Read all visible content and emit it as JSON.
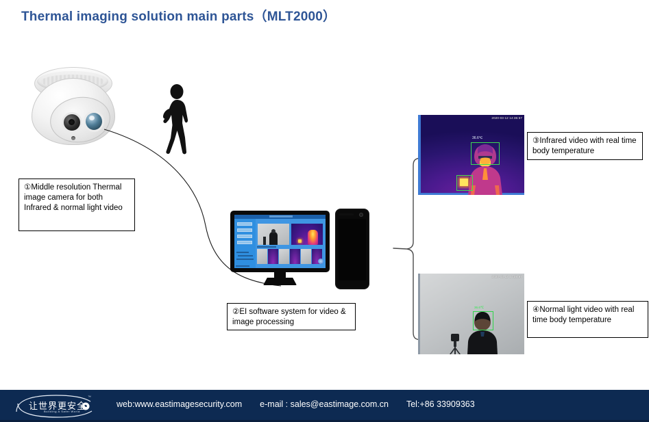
{
  "slide": {
    "title": "Thermal imaging solution  main parts（MLT2000）"
  },
  "callouts": [
    {
      "id": 1,
      "marker": "①",
      "text": "Middle resolution Thermal image camera for both Infrared & normal light video"
    },
    {
      "id": 2,
      "marker": "②",
      "text": "EI software system for video & image processing"
    },
    {
      "id": 3,
      "marker": "③",
      "text": "Infrared video with real time body temperature"
    },
    {
      "id": 4,
      "marker": "④",
      "text": "Normal light video with real time body temperature"
    }
  ],
  "diagram": {
    "camera_label": "dome-turret-camera",
    "person_label": "walking-person-silhouette",
    "monitor_label": "desktop-monitor",
    "phone_label": "mobile-phone"
  },
  "videos": {
    "infrared": {
      "timestamp": "2020-03-12 14:36:57",
      "temperature": "36.6℃",
      "palette_low": "#1a0e58",
      "palette_high": "#ffe45e",
      "box_color": "#3ddc52"
    },
    "visible": {
      "timestamp": "2020-03-12 14:36:57",
      "temperature": "36.6℃",
      "box_color": "#2fd44a"
    }
  },
  "footer": {
    "logo_cn": "让世界更安全",
    "logo_en": "Building A Safer World",
    "logo_tm": "™",
    "web": "web:www.eastimagesecurity.com",
    "email": "e-mail : sales@eastimage.com.cn",
    "tel": "Tel:+86 33909363",
    "background": "#0d2a52"
  },
  "colors": {
    "title": "#2e5596",
    "footer_bg": "#0d2a52",
    "slide_bg": "#ffffff"
  }
}
